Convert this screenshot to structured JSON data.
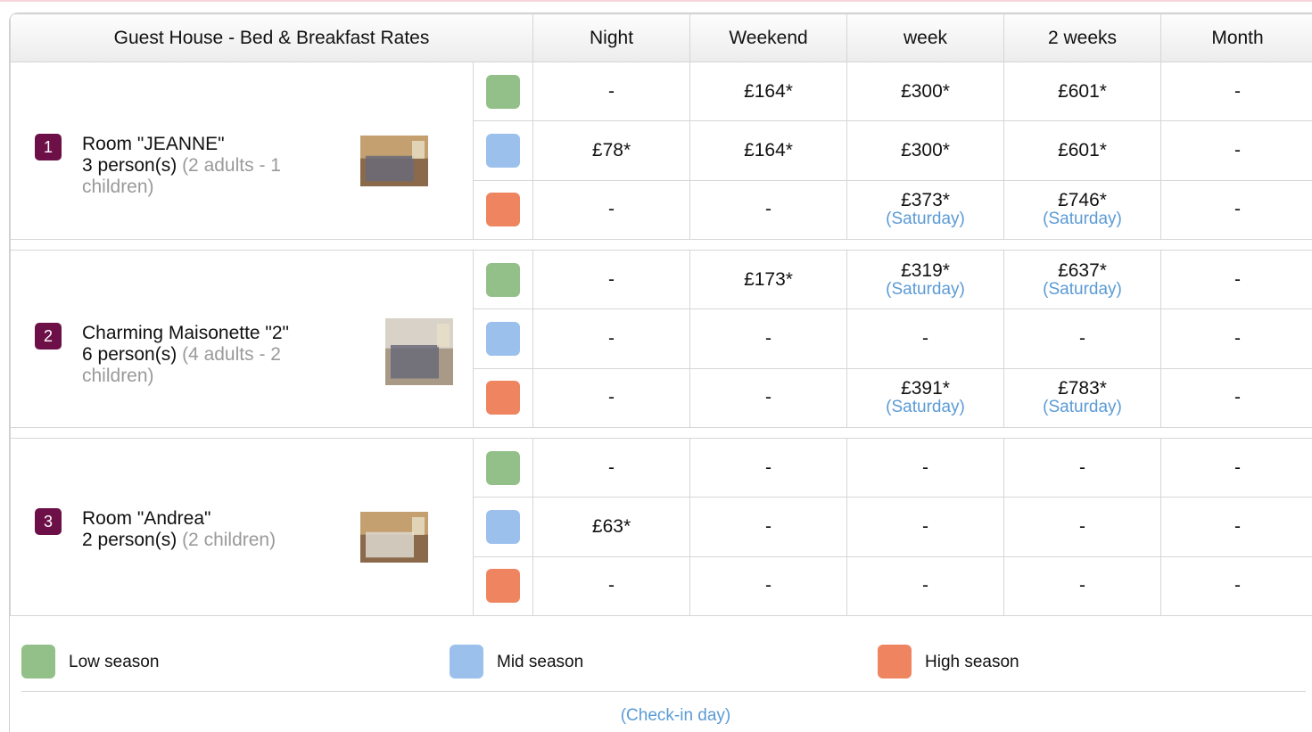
{
  "colors": {
    "low": "#92c088",
    "mid": "#9cc0ec",
    "high": "#ee8560",
    "badge": "#6d1048",
    "link": "#5b9bd5"
  },
  "header": {
    "title": "Guest House - Bed & Breakfast Rates",
    "columns": [
      "Night",
      "Weekend",
      "week",
      "2 weeks",
      "Month"
    ]
  },
  "rooms": [
    {
      "number": "1",
      "name": "Room \"JEANNE\"",
      "persons": "3 person(s)",
      "detail": "(2 adults - 1 children)",
      "photo_icon": "bedroom-photo",
      "rows": [
        {
          "season": "low",
          "night": "-",
          "weekend": "£164*",
          "week": "£300*",
          "week_day": "",
          "two_weeks": "£601*",
          "two_weeks_day": "",
          "month": "-"
        },
        {
          "season": "mid",
          "night": "£78*",
          "weekend": "£164*",
          "week": "£300*",
          "week_day": "",
          "two_weeks": "£601*",
          "two_weeks_day": "",
          "month": "-"
        },
        {
          "season": "high",
          "night": "-",
          "weekend": "-",
          "week": "£373*",
          "week_day": "(Saturday)",
          "two_weeks": "£746*",
          "two_weeks_day": "(Saturday)",
          "month": "-"
        }
      ]
    },
    {
      "number": "2",
      "name": "Charming Maisonette \"2\"",
      "persons": "6 person(s)",
      "detail": "(4 adults - 2 children)",
      "photo_icon": "maisonette-photo",
      "rows": [
        {
          "season": "low",
          "night": "-",
          "weekend": "£173*",
          "week": "£319*",
          "week_day": "(Saturday)",
          "two_weeks": "£637*",
          "two_weeks_day": "(Saturday)",
          "month": "-"
        },
        {
          "season": "mid",
          "night": "-",
          "weekend": "-",
          "week": "-",
          "week_day": "",
          "two_weeks": "-",
          "two_weeks_day": "",
          "month": "-"
        },
        {
          "season": "high",
          "night": "-",
          "weekend": "-",
          "week": "£391*",
          "week_day": "(Saturday)",
          "two_weeks": "£783*",
          "two_weeks_day": "(Saturday)",
          "month": "-"
        }
      ]
    },
    {
      "number": "3",
      "name": "Room \"Andrea\"",
      "persons": "2 person(s)",
      "detail": "(2 children)",
      "photo_icon": "bedroom-photo",
      "rows": [
        {
          "season": "low",
          "night": "-",
          "weekend": "-",
          "week": "-",
          "week_day": "",
          "two_weeks": "-",
          "two_weeks_day": "",
          "month": "-"
        },
        {
          "season": "mid",
          "night": "£63*",
          "weekend": "-",
          "week": "-",
          "week_day": "",
          "two_weeks": "-",
          "two_weeks_day": "",
          "month": "-"
        },
        {
          "season": "high",
          "night": "-",
          "weekend": "-",
          "week": "-",
          "week_day": "",
          "two_weeks": "-",
          "two_weeks_day": "",
          "month": "-"
        }
      ]
    }
  ],
  "legend": {
    "low_label": "Low season",
    "mid_label": "Mid season",
    "high_label": "High season",
    "checkin_note": "(Check-in day)"
  }
}
